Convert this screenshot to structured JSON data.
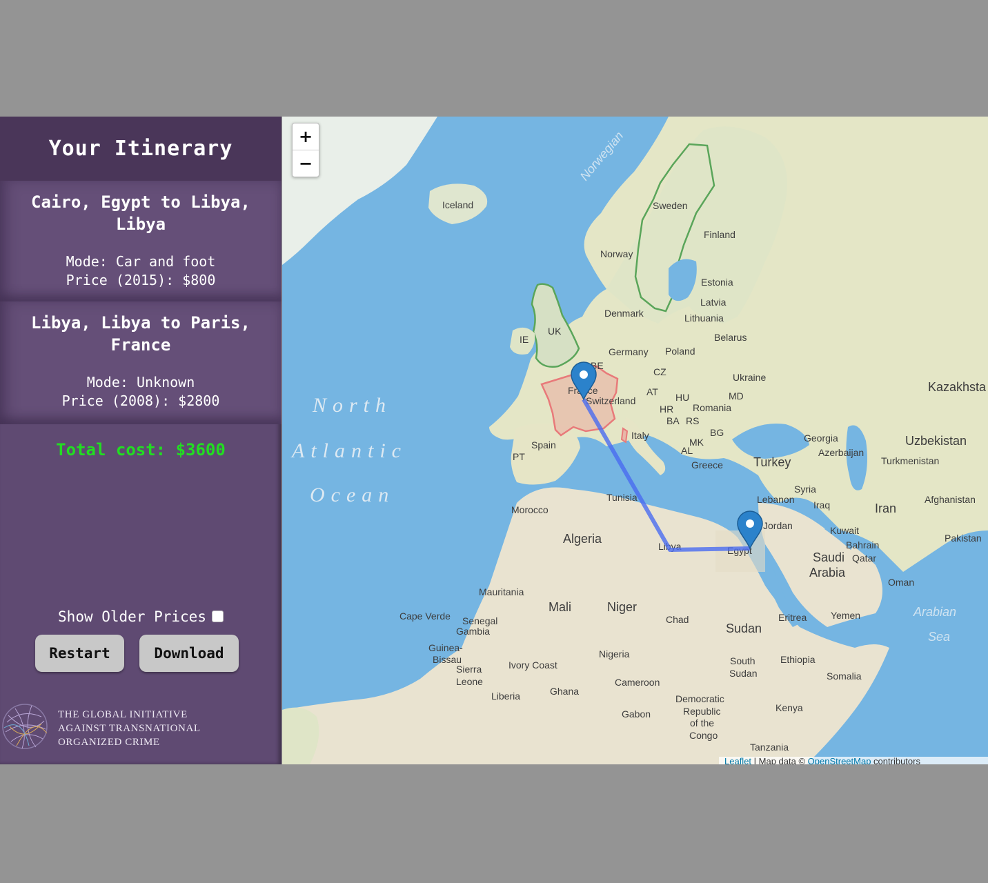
{
  "sidebar": {
    "title": "Your Itinerary",
    "legs": [
      {
        "title": "Cairo, Egypt to Libya, Libya",
        "mode": "Mode: Car and foot",
        "price": "Price (2015): $800"
      },
      {
        "title": "Libya, Libya to Paris, France",
        "mode": "Mode: Unknown",
        "price": "Price (2008): $2800"
      }
    ],
    "total": "Total cost: $3600",
    "show_older_label": "Show Older Prices",
    "show_older_checked": false,
    "restart_label": "Restart",
    "download_label": "Download",
    "logo_text": [
      "THE GLOBAL INITIATIVE",
      "AGAINST TRANSNATIONAL",
      "ORGANIZED CRIME"
    ]
  },
  "map": {
    "zoom_in": "+",
    "zoom_out": "−",
    "attribution": {
      "leaflet": "Leaflet",
      "sep": " | Map data © ",
      "osm": "OpenStreetMap",
      "suffix": " contributors"
    },
    "colors": {
      "route": "#4a6cf0",
      "highlight_france": "#e87a7a",
      "highlight_uk_sweden": "#5aa55a",
      "marker": "#2b82cb"
    },
    "oceans": [
      "North",
      "Atlantic",
      "Ocean"
    ],
    "seas": {
      "arabian": "Arabian",
      "sea": "Sea",
      "norwegian": "Norwegian"
    },
    "labels": {
      "iceland": "Iceland",
      "sweden": "Sweden",
      "finland": "Finland",
      "norway": "Norway",
      "estonia": "Estonia",
      "latvia": "Latvia",
      "lithuania": "Lithuania",
      "denmark": "Denmark",
      "belarus": "Belarus",
      "uk": "UK",
      "ie": "IE",
      "germany": "Germany",
      "poland": "Poland",
      "be": "BE",
      "cz": "CZ",
      "ukraine": "Ukraine",
      "kazakhstan": "Kazakhsta",
      "france": "France",
      "switzerland": "Switzerland",
      "at": "AT",
      "hu": "HU",
      "md": "MD",
      "romania": "Romania",
      "hr": "HR",
      "ba": "BA",
      "rs": "RS",
      "italy": "Italy",
      "bg": "BG",
      "mk": "MK",
      "al": "AL",
      "spain": "Spain",
      "pt": "PT",
      "georgia": "Georgia",
      "azerbaijan": "Azerbaijan",
      "uzbekistan": "Uzbekistan",
      "turkmenistan": "Turkmenistan",
      "turkey": "Turkey",
      "greece": "Greece",
      "syria": "Syria",
      "lebanon": "Lebanon",
      "iraq": "Iraq",
      "iran": "Iran",
      "afghanistan": "Afghanistan",
      "tunisia": "Tunisia",
      "morocco": "Morocco",
      "algeria": "Algeria",
      "libya": "Libya",
      "egypt": "Egypt",
      "jordan": "Jordan",
      "kuwait": "Kuwait",
      "bahrain": "Bahrain",
      "qatar": "Qatar",
      "pakistan": "Pakistan",
      "saudi": "Saudi",
      "arabia": "Arabia",
      "oman": "Oman",
      "mauritania": "Mauritania",
      "mali": "Mali",
      "niger": "Niger",
      "chad": "Chad",
      "sudan": "Sudan",
      "eritrea": "Eritrea",
      "yemen": "Yemen",
      "cape_verde": "Cape Verde",
      "senegal": "Senegal",
      "gambia": "Gambia",
      "guinea_bissau_1": "Guinea-",
      "guinea_bissau_2": "Bissau",
      "sierra": "Sierra",
      "leone": "Leone",
      "ivory_coast": "Ivory Coast",
      "liberia": "Liberia",
      "ghana": "Ghana",
      "nigeria": "Nigeria",
      "cameroon": "Cameroon",
      "south": "South",
      "south_sudan": "Sudan",
      "ethiopia": "Ethiopia",
      "somalia": "Somalia",
      "gabon": "Gabon",
      "drc_1": "Democratic",
      "drc_2": "Republic",
      "drc_3": "of the",
      "drc_4": "Congo",
      "kenya": "Kenya",
      "tanzania": "Tanzania"
    }
  }
}
